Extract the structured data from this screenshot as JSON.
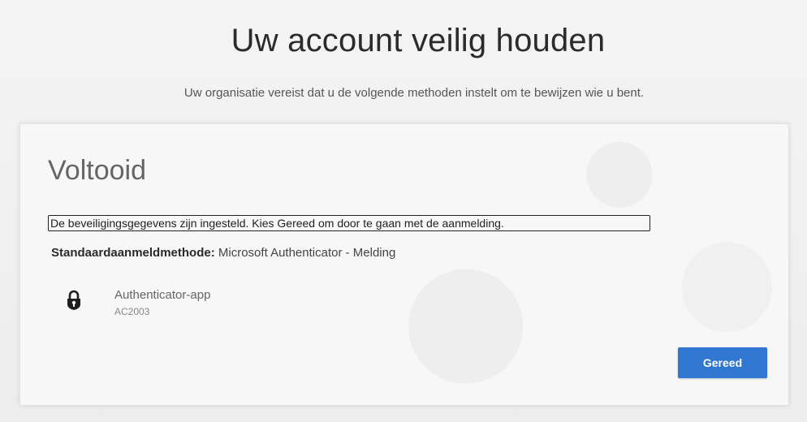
{
  "page": {
    "title": "Uw account veilig houden",
    "subtitle": "Uw organisatie vereist dat u de volgende methoden instelt om te bewijzen wie u bent."
  },
  "card": {
    "title": "Voltooid",
    "status_message": "De beveiligingsgegevens zijn ingesteld. Kies Gereed om door te gaan met de aanmelding.",
    "default_method_label": "Standaardaanmeldmethode:",
    "default_method_value": "Microsoft Authenticator - Melding",
    "methods": [
      {
        "icon": "authenticator-lock-icon",
        "name": "Authenticator-app",
        "detail": "AC2003"
      }
    ],
    "done_button_label": "Gereed"
  },
  "colors": {
    "accent": "#2f77d1",
    "background": "#ededed"
  }
}
